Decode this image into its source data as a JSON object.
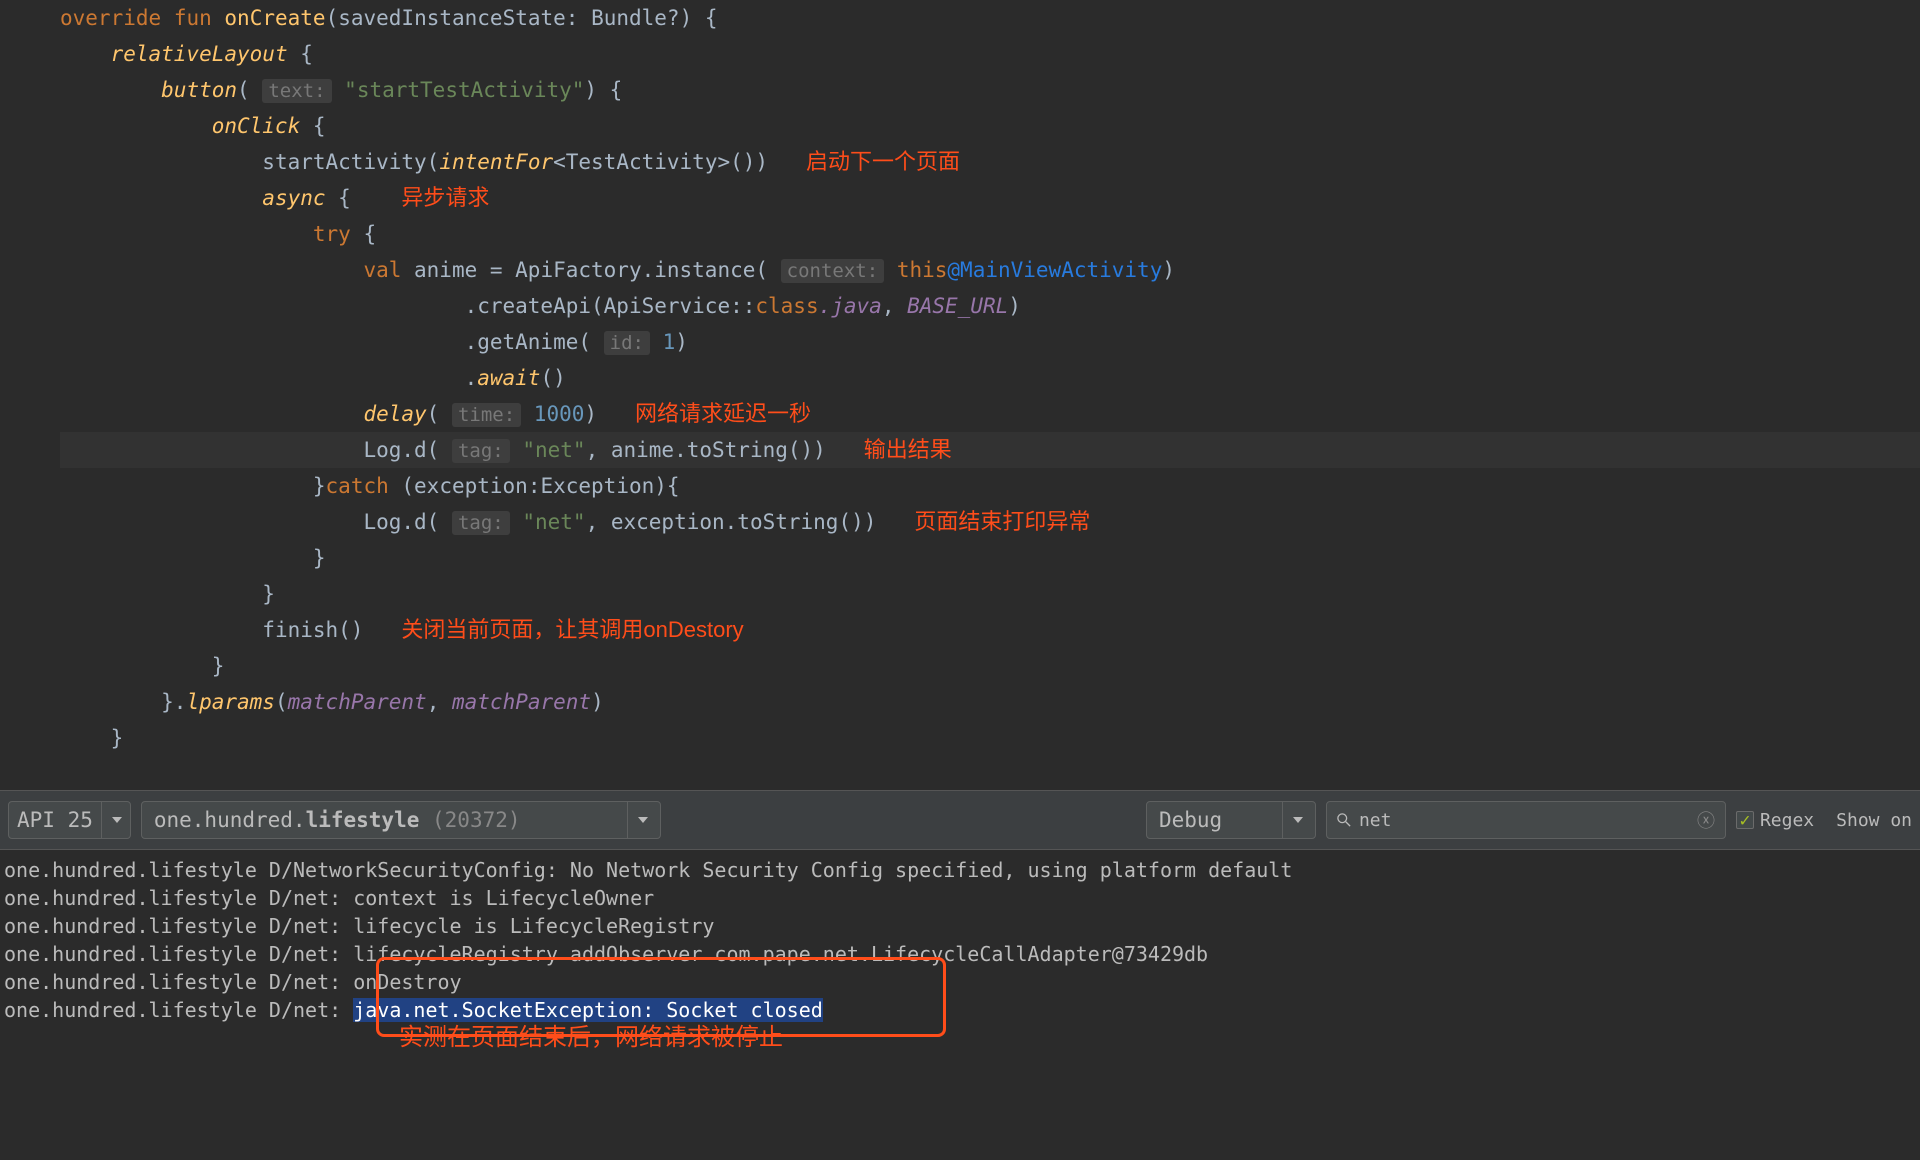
{
  "code": {
    "line1": {
      "override": "override",
      "fun": "fun",
      "onCreate": "onCreate",
      "param": "(savedInstanceState: Bundle?) {"
    },
    "line2": {
      "relativeLayout": "relativeLayout",
      "brace": " {"
    },
    "line3": {
      "button": "button",
      "paren": "( ",
      "hint": "text:",
      "string": "\"startTestActivity\"",
      "close": ") {"
    },
    "line4": {
      "onClick": "onClick",
      "brace": " {"
    },
    "line5": {
      "startActivity": "startActivity(",
      "intentFor": "intentFor",
      "generic": "<TestActivity>())",
      "comment": "启动下一个页面"
    },
    "line6": {
      "async": "async",
      "brace": " {",
      "comment": "异步请求"
    },
    "line7": {
      "try": "try",
      "brace": " {"
    },
    "line8": {
      "val": "val",
      "anime": " anime = ApiFactory.instance( ",
      "hint": "context:",
      "this": " this",
      "at": "@MainViewActivity",
      "close": ")"
    },
    "line9": {
      "dot": ".createApi(ApiService::",
      "class": "class",
      "java": ".java",
      "comma": ", ",
      "baseurl": "BASE_URL",
      "close": ")"
    },
    "line10": {
      "dot": ".getAnime( ",
      "hint": "id:",
      "num": " 1",
      "close": ")"
    },
    "line11": {
      "dot": ".",
      "await": "await",
      "close": "()"
    },
    "line12": {
      "delay": "delay",
      "paren": "( ",
      "hint": "time:",
      "num": " 1000",
      "close": ")",
      "comment": "网络请求延迟一秒"
    },
    "line13": {
      "log": "Log.d( ",
      "hint": "tag:",
      "string": " \"net\"",
      "rest": ", anime.toString())",
      "comment": "输出结果"
    },
    "line14": {
      "brace": "}",
      "catch": "catch",
      "rest": " (exception:Exception){"
    },
    "line15": {
      "log": "Log.d( ",
      "hint": "tag:",
      "string": " \"net\"",
      "rest": ", exception.toString())",
      "comment": "页面结束打印异常"
    },
    "line16": {
      "brace": "}"
    },
    "line17": {
      "brace": "}"
    },
    "line18": {
      "finish": "finish()",
      "comment": "关闭当前页面，让其调用onDestory"
    },
    "line19": {
      "brace": "}"
    },
    "line20": {
      "brace": "}.",
      "lparams": "lparams",
      "paren": "(",
      "mp1": "matchParent",
      "comma": ", ",
      "mp2": "matchParent",
      "close": ")"
    },
    "line21": {
      "brace": "}"
    }
  },
  "toolbar": {
    "api_label": "API 25",
    "process_prefix": "one.hundred.",
    "process_bold": "lifestyle",
    "process_suffix": " (20372)",
    "level": "Debug",
    "search_value": "net",
    "regex": "Regex",
    "show": "Show on"
  },
  "log": {
    "l1": "one.hundred.lifestyle D/NetworkSecurityConfig: No Network Security Config specified, using platform default",
    "l2": "one.hundred.lifestyle D/net: context is LifecycleOwner",
    "l3": "one.hundred.lifestyle D/net: lifecycle is LifecycleRegistry",
    "l4": "one.hundred.lifestyle D/net: lifecycleRegistry addObserver com.pape.net.LifecycleCallAdapter@73429db",
    "l5": "one.hundred.lifestyle D/net: onDestroy",
    "l6_prefix": "one.hundred.lifestyle D/net: ",
    "l6_highlight": "java.net.SocketException: Socket closed",
    "annotation": "实测在页面结束后，网络请求被停止"
  }
}
